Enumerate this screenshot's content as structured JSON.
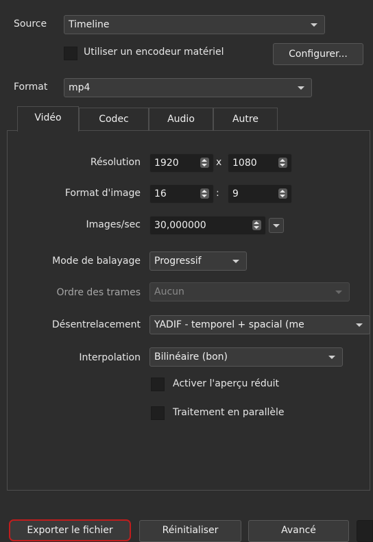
{
  "source": {
    "label": "Source",
    "value": "Timeline"
  },
  "hardware_encoder": {
    "label": "Utiliser un encodeur matériel",
    "configure_label": "Configurer..."
  },
  "format": {
    "label": "Format",
    "value": "mp4"
  },
  "tabs": [
    {
      "label": "Vidéo",
      "active": true
    },
    {
      "label": "Codec",
      "active": false
    },
    {
      "label": "Audio",
      "active": false
    },
    {
      "label": "Autre",
      "active": false
    }
  ],
  "video": {
    "resolution": {
      "label": "Résolution",
      "width": "1920",
      "separator": "x",
      "height": "1080"
    },
    "aspect_ratio": {
      "label": "Format d'image",
      "num": "16",
      "separator": ":",
      "den": "9"
    },
    "fps": {
      "label": "Images/sec",
      "value": "30,000000"
    },
    "scan_mode": {
      "label": "Mode de balayage",
      "value": "Progressif"
    },
    "field_order": {
      "label": "Ordre des trames",
      "value": "Aucun"
    },
    "deinterlacer": {
      "label": "Désentrelacement",
      "value": "YADIF - temporel + spacial (me"
    },
    "interpolation": {
      "label": "Interpolation",
      "value": "Bilinéaire (bon)"
    },
    "preview_scaling": {
      "label": "Activer l'aperçu réduit"
    },
    "parallel": {
      "label": "Traitement en parallèle"
    }
  },
  "footer": {
    "export_label": "Exporter le fichier",
    "reset_label": "Réinitialiser",
    "advanced_label": "Avancé"
  },
  "colors": {
    "background": "#2d2d2d",
    "highlight_outline": "#c11d1d"
  }
}
